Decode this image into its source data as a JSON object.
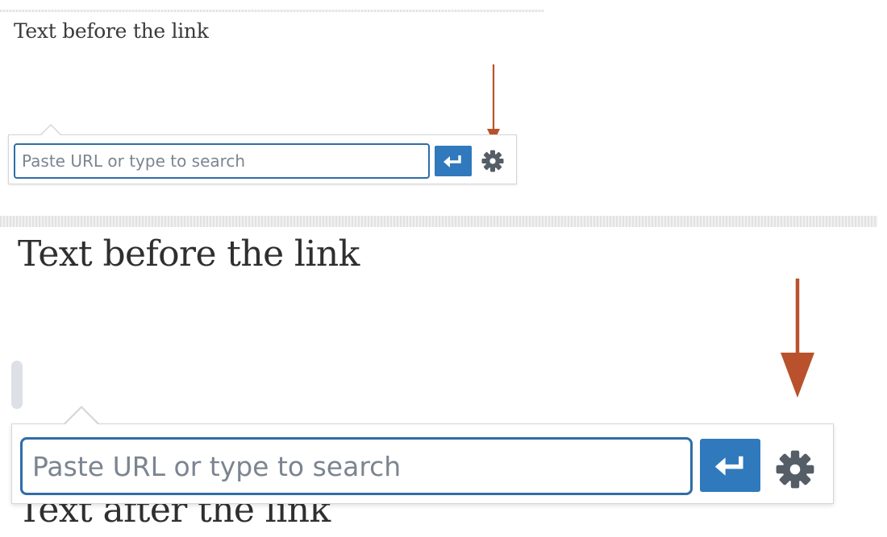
{
  "small_panel": {
    "paragraph_before": "Text before the link",
    "link_input": {
      "placeholder": "Paste URL or type to search",
      "value": ""
    },
    "submit_icon": "enter-return-icon",
    "settings_icon": "gear-icon"
  },
  "large_panel": {
    "paragraph_before": "Text before the link",
    "paragraph_after": "Text after the link",
    "link_input": {
      "placeholder": "Paste URL or type to search",
      "value": ""
    },
    "submit_icon": "enter-return-icon",
    "settings_icon": "gear-icon"
  },
  "colors": {
    "accent_blue": "#2f79bc",
    "input_border": "#2f6da8",
    "annotation_arrow": "#b9522c",
    "icon_gray": "#555d66",
    "body_text": "#2f2f2f"
  }
}
